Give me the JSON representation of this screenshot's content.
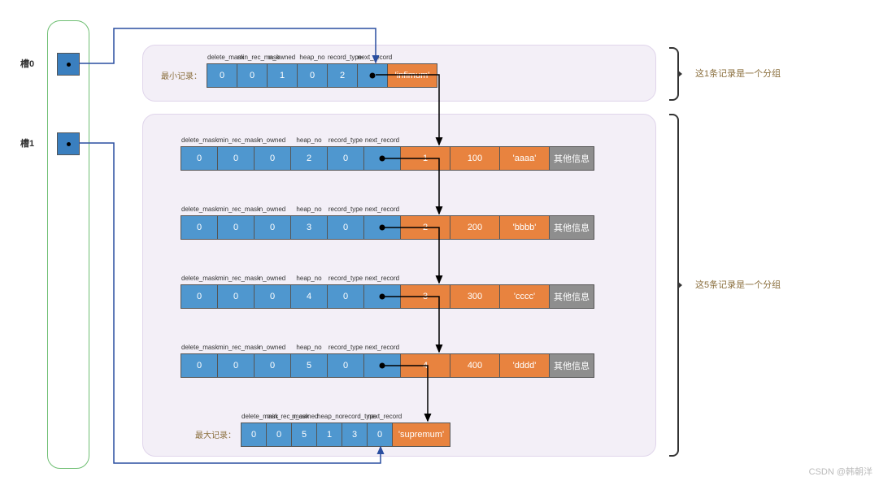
{
  "slots": {
    "s0_label": "槽0",
    "s1_label": "槽1"
  },
  "top": {
    "title": "最小记录：",
    "headers": [
      "delete_mask",
      "min_rec_mask",
      "n_owned",
      "heap_no",
      "record_type",
      "next_record"
    ],
    "cells": [
      "0",
      "0",
      "1",
      "0",
      "2",
      ""
    ],
    "payload": "'infimum'"
  },
  "rows": [
    {
      "headers": [
        "delete_mask",
        "min_rec_mask",
        "n_owned",
        "heap_no",
        "record_type",
        "next_record"
      ],
      "cells": [
        "0",
        "0",
        "0",
        "2",
        "0",
        ""
      ],
      "data": [
        "1",
        "100",
        "'aaaa'"
      ],
      "extra": "其他信息"
    },
    {
      "headers": [
        "delete_mask",
        "min_rec_mask",
        "n_owned",
        "heap_no",
        "record_type",
        "next_record"
      ],
      "cells": [
        "0",
        "0",
        "0",
        "3",
        "0",
        ""
      ],
      "data": [
        "2",
        "200",
        "'bbbb'"
      ],
      "extra": "其他信息"
    },
    {
      "headers": [
        "delete_mask",
        "min_rec_mask",
        "n_owned",
        "heap_no",
        "record_type",
        "next_record"
      ],
      "cells": [
        "0",
        "0",
        "0",
        "4",
        "0",
        ""
      ],
      "data": [
        "3",
        "300",
        "'cccc'"
      ],
      "extra": "其他信息"
    },
    {
      "headers": [
        "delete_mask",
        "min_rec_mask",
        "n_owned",
        "heap_no",
        "record_type",
        "next_record"
      ],
      "cells": [
        "0",
        "0",
        "0",
        "5",
        "0",
        ""
      ],
      "data": [
        "4",
        "400",
        "'dddd'"
      ],
      "extra": "其他信息"
    }
  ],
  "bottom": {
    "title": "最大记录：",
    "headers": [
      "delete_mask",
      "min_rec_mask",
      "n_owned",
      "heap_no",
      "record_type",
      "next_record"
    ],
    "cells": [
      "0",
      "0",
      "5",
      "1",
      "3",
      "0"
    ],
    "payload": "'supremum'"
  },
  "annotations": {
    "top": "这1条记录是一个分组",
    "bottom": "这5条记录是一个分组"
  },
  "watermark": "CSDN @韩朝洋"
}
